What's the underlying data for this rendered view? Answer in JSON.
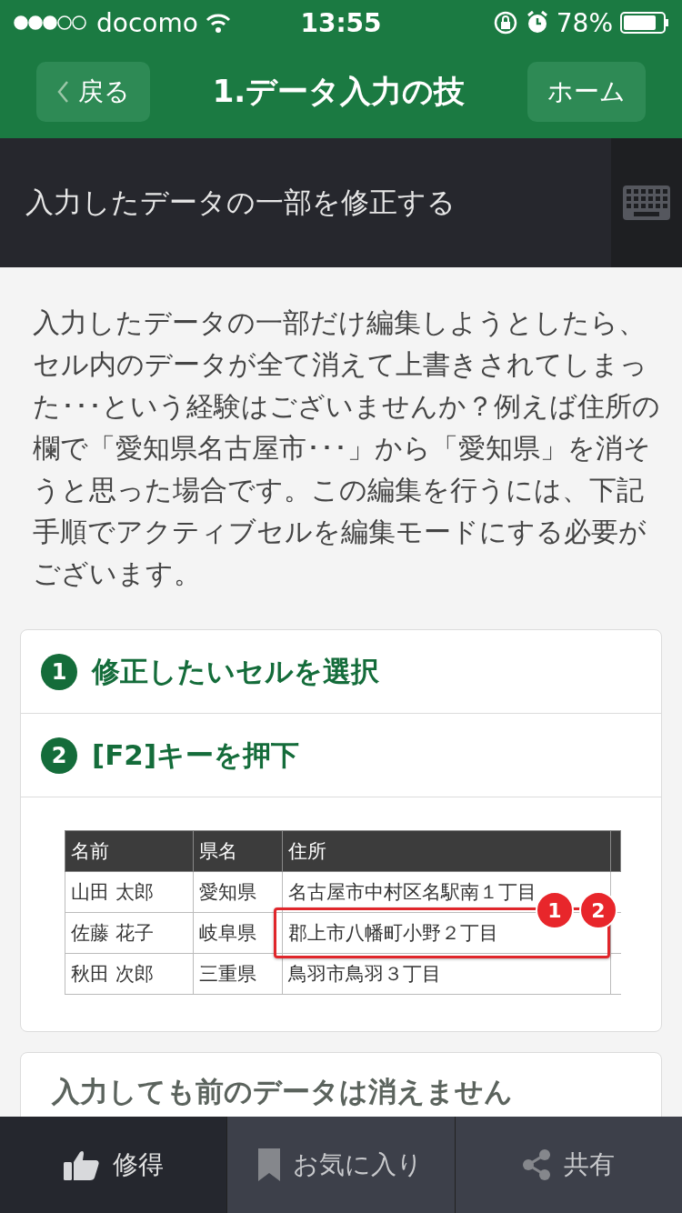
{
  "status_bar": {
    "carrier": "docomo",
    "time": "13:55",
    "battery": "78%"
  },
  "nav": {
    "back": "戻る",
    "title": "1.データ入力の技",
    "home": "ホーム"
  },
  "subheader": {
    "title": "入力したデータの一部を修正する"
  },
  "intro": "入力したデータの一部だけ編集しようとしたら、セル内のデータが全て消えて上書きされてしまった･･･という経験はございませんか？例えば住所の欄で「愛知県名古屋市･･･」から「愛知県」を消そうと思った場合です。この編集を行うには、下記手順でアクティブセルを編集モードにする必要がございます。",
  "steps": [
    {
      "number": "1",
      "text": "修正したいセルを選択"
    },
    {
      "number": "2",
      "text": "[F2]キーを押下"
    }
  ],
  "table": {
    "columns": [
      "名前",
      "県名",
      "住所"
    ],
    "rows": [
      {
        "cells": [
          "山田 太郎",
          "愛知県",
          "名古屋市中村区名駅南１丁目"
        ],
        "selected": false
      },
      {
        "cells": [
          "佐藤 花子",
          "岐阜県",
          "郡上市八幡町小野２丁目"
        ],
        "selected": true
      },
      {
        "cells": [
          "秋田 次郎",
          "三重県",
          "鳥羽市鳥羽３丁目"
        ],
        "selected": false
      }
    ],
    "callouts": [
      "1",
      "2"
    ]
  },
  "next_card": {
    "title": "入力しても前のデータは消えません"
  },
  "tab_bar": [
    {
      "kind": "thumb",
      "label": "修得",
      "selected": true
    },
    {
      "kind": "bookmark",
      "label": "お気に入り",
      "selected": false
    },
    {
      "kind": "share",
      "label": "共有",
      "selected": false
    }
  ]
}
